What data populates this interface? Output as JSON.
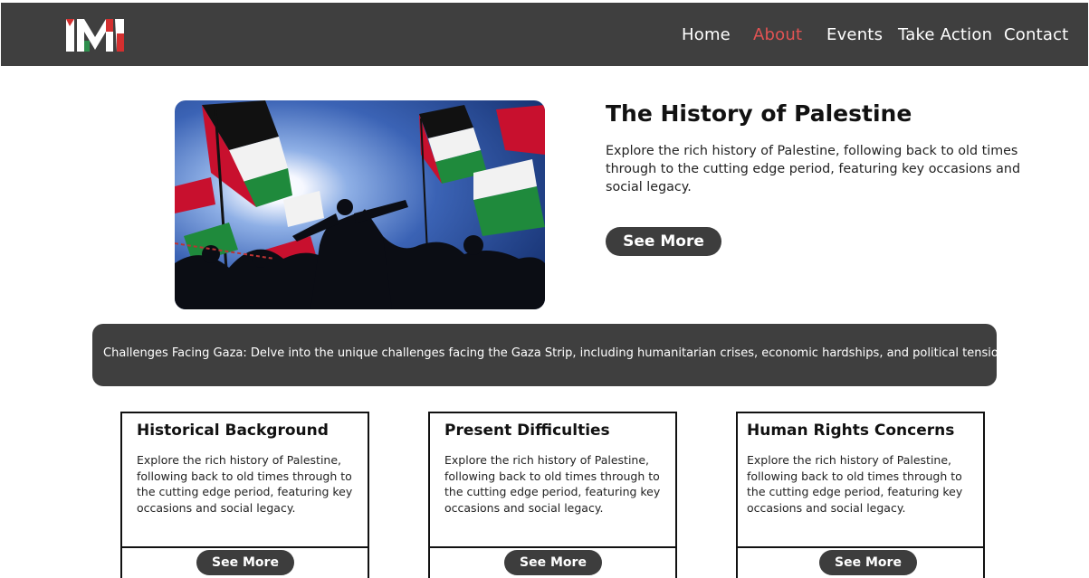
{
  "nav": {
    "logo_text": "MI",
    "items": [
      "Home",
      "About",
      "Events",
      "Take Action",
      "Contact"
    ],
    "active_item": "About",
    "colors": {
      "bar": "#3f3f3f",
      "active": "#e25353",
      "logo_red": "#d32f2f"
    }
  },
  "hero": {
    "image_description": "Silhouettes of people waving Palestinian flags against a bright sun",
    "title": "The History of Palestine",
    "description": "Explore the rich history of Palestine, following back to old times through to the cutting edge period, featuring key occasions and social legacy.",
    "button_label": "See More"
  },
  "banner": {
    "text": "Challenges Facing Gaza: Delve into the unique challenges facing the Gaza Strip, including humanitarian crises, economic hardships, and political tensions."
  },
  "cards": [
    {
      "title": "Historical Background",
      "description": "Explore the rich history of Palestine, following back to old times through to the cutting edge period, featuring key occasions and social legacy.",
      "button_label": "See More"
    },
    {
      "title": "Present Difficulties",
      "description": "Explore the rich history of Palestine, following back to old times through to the cutting edge period, featuring key occasions and social legacy.",
      "button_label": "See More"
    },
    {
      "title": "Human Rights Concerns",
      "description": "Explore the rich history of Palestine, following back to old times through to the cutting edge period, featuring key occasions and social legacy.",
      "button_label": "See More"
    }
  ]
}
